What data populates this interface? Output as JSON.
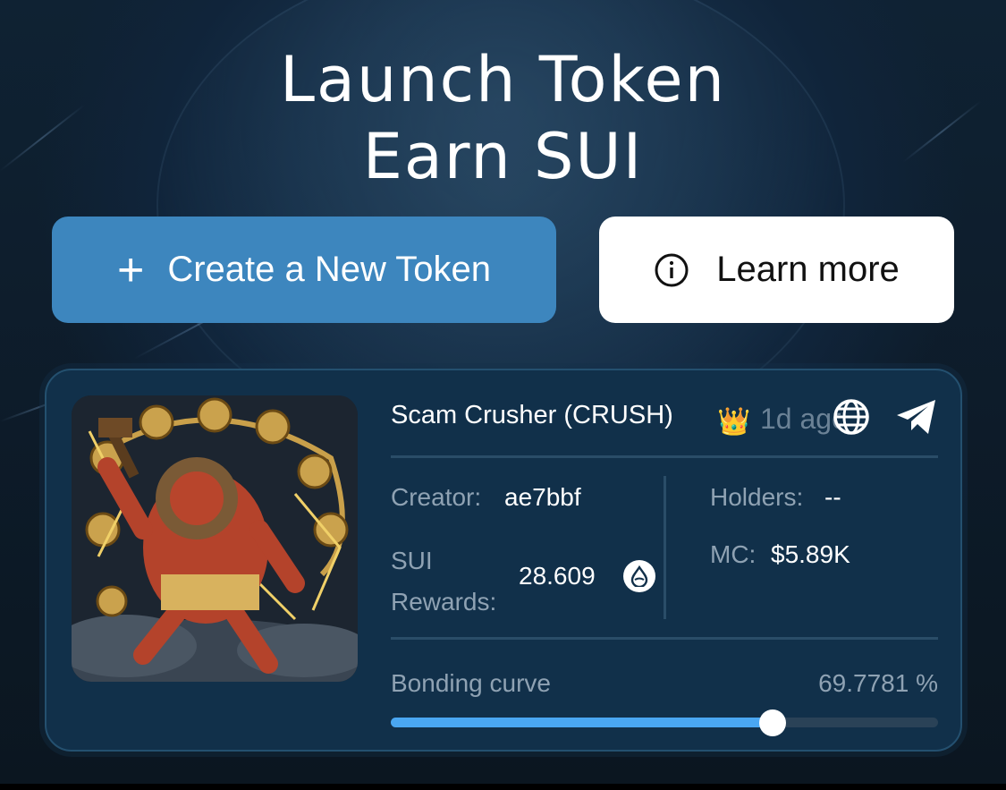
{
  "hero": {
    "title_line1": "Launch Token",
    "title_line2": "Earn SUI"
  },
  "actions": {
    "create_label": "Create a New Token",
    "create_icon": "plus-icon",
    "learn_label": "Learn more",
    "learn_icon": "info-icon"
  },
  "token": {
    "name": "Scam Crusher (CRUSH)",
    "badge": "👑",
    "age": "1d ago",
    "creator_label": "Creator:",
    "creator_value": "ae7bbf",
    "holders_label": "Holders:",
    "holders_value": "--",
    "rewards_label_line1": "SUI",
    "rewards_label_line2": "Rewards:",
    "rewards_value": "28.609",
    "rewards_icon": "sui-drop-icon",
    "mc_label": "MC:",
    "mc_value": "$5.89K",
    "bonding_label": "Bonding curve",
    "bonding_value": "69.7781 %",
    "bonding_fraction": 0.697781,
    "links": [
      "globe-icon",
      "telegram-icon"
    ]
  },
  "colors": {
    "accent": "#3d86be",
    "progress": "#4aa7f2",
    "card_bg": "#11304a"
  }
}
